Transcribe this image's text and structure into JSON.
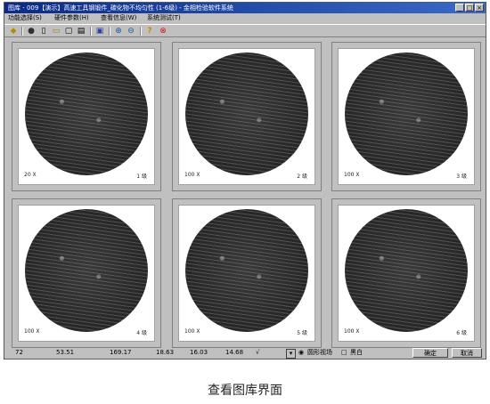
{
  "window": {
    "title": "图库 - 009【演示】高速工具钢锻件_碳化物不均匀性 (1-6级) - 金相检验软件系统"
  },
  "title_controls": [
    "_",
    "□",
    "×"
  ],
  "menu": [
    {
      "label": "功能选择(S)"
    },
    {
      "label": "硬件参数(H)"
    },
    {
      "label": "查看信息(W)"
    },
    {
      "label": "系统测试(T)"
    }
  ],
  "toolbar": [
    {
      "name": "nav-icon",
      "glyph": "◆"
    },
    {
      "name": "record-icon",
      "glyph": "●"
    },
    {
      "name": "new-icon",
      "glyph": "▯"
    },
    {
      "name": "open-icon",
      "glyph": "▭"
    },
    {
      "name": "copy-icon",
      "glyph": "▢"
    },
    {
      "name": "paste-icon",
      "glyph": "▤"
    },
    {
      "name": "save-icon",
      "glyph": "▣"
    },
    {
      "name": "zoom-in-icon",
      "glyph": "⊕"
    },
    {
      "name": "zoom-out-icon",
      "glyph": "⊖"
    },
    {
      "name": "help-icon",
      "glyph": "?"
    },
    {
      "name": "stop-icon",
      "glyph": "⊗"
    }
  ],
  "images": [
    {
      "mag": "20 X",
      "grade": "1 级"
    },
    {
      "mag": "100 X",
      "grade": "2 级"
    },
    {
      "mag": "100 X",
      "grade": "3 级"
    },
    {
      "mag": "100 X",
      "grade": "4 级"
    },
    {
      "mag": "100 X",
      "grade": "5 级"
    },
    {
      "mag": "100 X",
      "grade": "6 级"
    }
  ],
  "status": {
    "values": [
      "72",
      "53.51",
      "169.17",
      "18.63",
      "16.03",
      "14.68",
      "√"
    ],
    "option1": "圆形视场",
    "option2": "黑白",
    "ok": "确定",
    "cancel": "取消"
  },
  "caption": "查看图库界面",
  "colors": {
    "titlebar": "#0a2a8a",
    "window": "#c0c0c0"
  }
}
